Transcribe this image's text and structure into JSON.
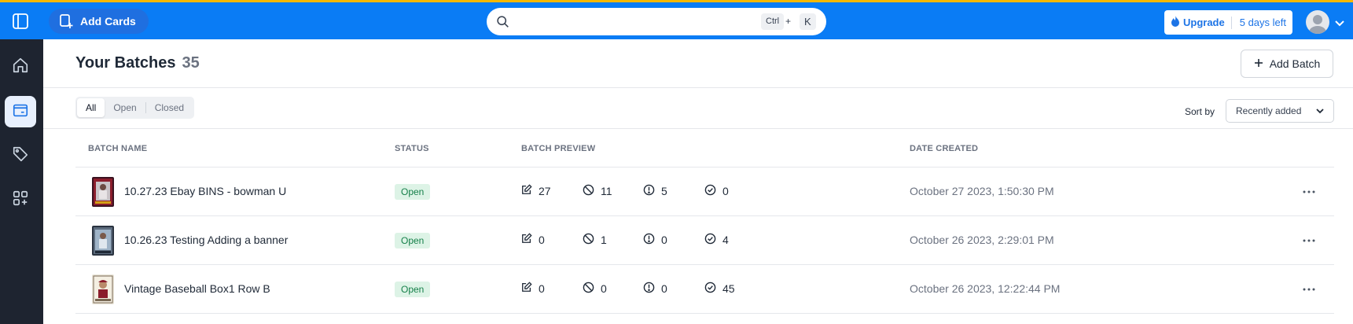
{
  "topbar": {
    "add_cards_label": "Add Cards",
    "search": {
      "placeholder": "",
      "shortcut_ctrl": "Ctrl",
      "shortcut_plus": "+",
      "shortcut_key": "K"
    },
    "upgrade_label": "Upgrade",
    "trial_label": "5 days left",
    "colors": {
      "bar": "#0a7cf5",
      "accent_border": "#f5b800"
    }
  },
  "sidebar": {
    "items": [
      {
        "icon": "home-icon",
        "active": false
      },
      {
        "icon": "batch-box-icon",
        "active": true
      },
      {
        "icon": "tag-icon",
        "active": false
      },
      {
        "icon": "apps-add-icon",
        "active": false
      }
    ]
  },
  "header": {
    "title": "Your Batches",
    "count": "35",
    "add_batch_label": "Add Batch"
  },
  "filters": {
    "tabs": [
      "All",
      "Open",
      "Closed"
    ],
    "active": "All",
    "sort_label": "Sort by",
    "sort_value": "Recently added"
  },
  "table": {
    "columns": {
      "name": "BATCH NAME",
      "status": "STATUS",
      "preview": "BATCH PREVIEW",
      "date": "DATE CREATED"
    },
    "rows": [
      {
        "name": "10.27.23 Ebay BINS - bowman U",
        "status": "Open",
        "edited": "27",
        "rejected": "11",
        "flagged": "5",
        "approved": "0",
        "date": "October 27 2023, 1:50:30 PM"
      },
      {
        "name": "10.26.23 Testing Adding a banner",
        "status": "Open",
        "edited": "0",
        "rejected": "1",
        "flagged": "0",
        "approved": "4",
        "date": "October 26 2023, 2:29:01 PM"
      },
      {
        "name": "Vintage Baseball Box1 Row B",
        "status": "Open",
        "edited": "0",
        "rejected": "0",
        "flagged": "0",
        "approved": "45",
        "date": "October 26 2023, 12:22:44 PM"
      }
    ]
  }
}
